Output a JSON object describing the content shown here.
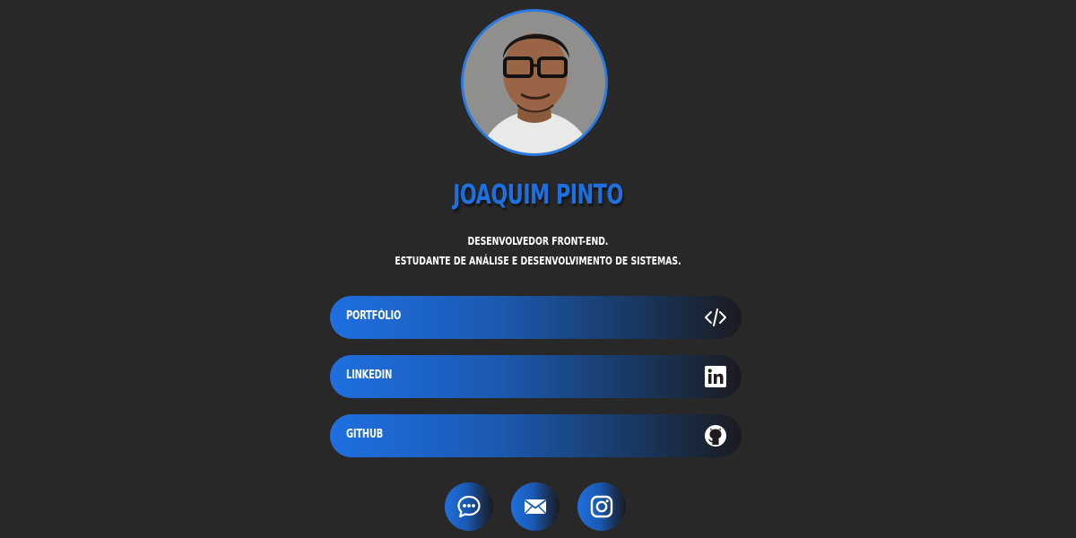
{
  "profile": {
    "name": "JOAQUIM PINTO",
    "bio_line1": "DESENVOLVEDOR FRONT-END.",
    "bio_line2": "ESTUDANTE DE ANÁLISE E DESENVOLVIMENTO DE SISTEMAS.",
    "accent_color": "#1e6fe0"
  },
  "links": [
    {
      "label": "PORTFÓLIO",
      "icon": "code-icon"
    },
    {
      "label": "LINKEDIN",
      "icon": "linkedin-icon"
    },
    {
      "label": "GITHUB",
      "icon": "github-icon"
    }
  ],
  "social": [
    {
      "icon": "chat-icon"
    },
    {
      "icon": "mail-icon"
    },
    {
      "icon": "instagram-icon"
    }
  ]
}
